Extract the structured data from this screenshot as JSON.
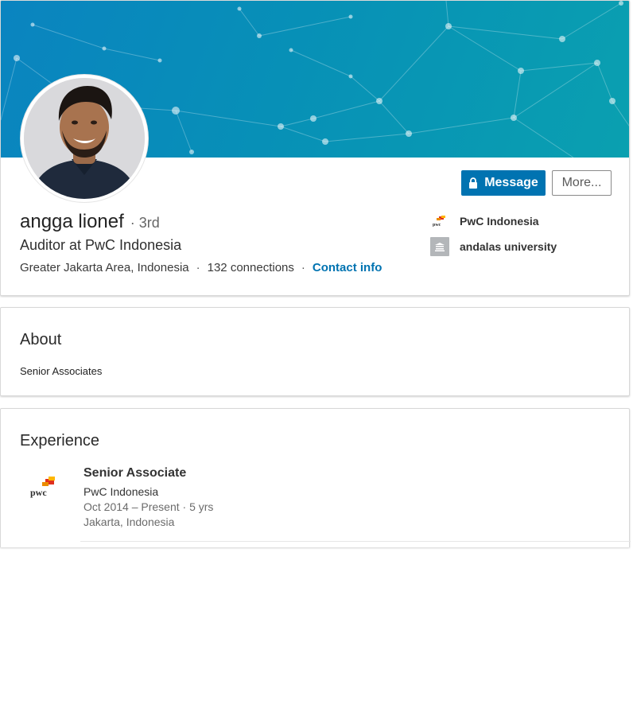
{
  "profile": {
    "name": "angga lionef",
    "degree": "3rd",
    "degree_separator": "·",
    "headline": "Auditor at PwC Indonesia",
    "location": "Greater Jakarta Area, Indonesia",
    "connections": "132 connections",
    "contact_label": "Contact info",
    "separator": "·"
  },
  "actions": {
    "message_label": "Message",
    "more_label": "More..."
  },
  "affiliations": {
    "company": "PwC Indonesia",
    "school": "andalas university"
  },
  "about": {
    "title": "About",
    "text": "Senior Associates"
  },
  "experience": {
    "title": "Experience",
    "items": [
      {
        "title": "Senior Associate",
        "company": "PwC Indonesia",
        "dates": "Oct 2014 – Present · 5 yrs",
        "location": "Jakarta, Indonesia"
      }
    ]
  },
  "colors": {
    "accent": "#0073b1",
    "banner": "#0790b7"
  },
  "icons": {
    "message": "lock-icon",
    "company_logo": "pwc-logo-icon",
    "school_logo": "school-building-icon"
  }
}
